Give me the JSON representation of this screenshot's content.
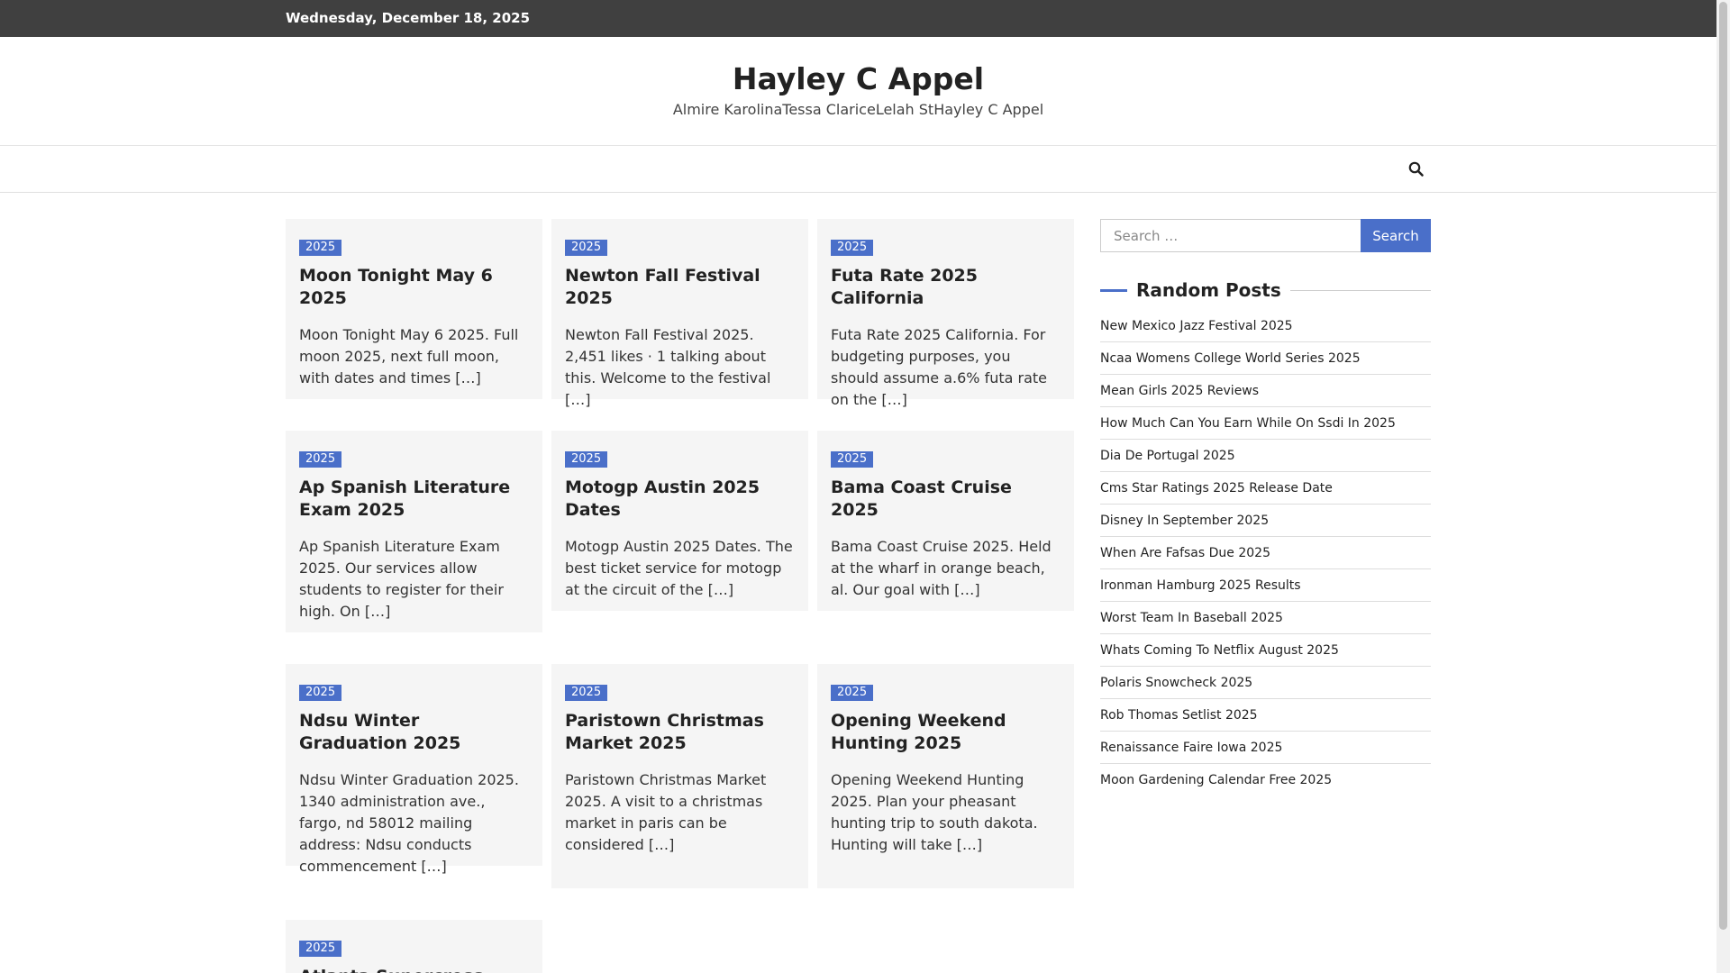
{
  "topbar": {
    "date": "Wednesday, December 18, 2025"
  },
  "header": {
    "title": "Hayley C Appel",
    "description": "Almire KarolinaTessa ClariceLelah StHayley C Appel"
  },
  "nav": {
    "search_icon": "search-icon"
  },
  "posts": [
    {
      "badge": "2025",
      "title": "Moon Tonight May 6 2025",
      "excerpt": "Moon Tonight May 6 2025. Full moon 2025, next full moon, with dates and times […]"
    },
    {
      "badge": "2025",
      "title": "Newton Fall Festival 2025",
      "excerpt": "Newton Fall Festival 2025. 2,451 likes · 1 talking about this. Welcome to the festival […]"
    },
    {
      "badge": "2025",
      "title": "Futa Rate 2025 California",
      "excerpt": "Futa Rate 2025 California. For budgeting purposes, you should assume a.6% futa rate on the […]"
    },
    {
      "badge": "2025",
      "title": "Ap Spanish Literature Exam 2025",
      "excerpt": "Ap Spanish Literature Exam 2025. Our services allow students to register for their high. On […]"
    },
    {
      "badge": "2025",
      "title": "Motogp Austin 2025 Dates",
      "excerpt": "Motogp Austin 2025 Dates. The best ticket service for motogp at the circuit of the […]"
    },
    {
      "badge": "2025",
      "title": "Bama Coast Cruise 2025",
      "excerpt": "Bama Coast Cruise 2025. Held at the wharf in orange beach, al. Our goal with […]"
    },
    {
      "badge": "2025",
      "title": "Ndsu Winter Graduation 2025",
      "excerpt": "Ndsu Winter Graduation 2025. 1340 administration ave., fargo, nd 58012 mailing address: Ndsu conducts commencement […]"
    },
    {
      "badge": "2025",
      "title": "Paristown Christmas Market 2025",
      "excerpt": "Paristown Christmas Market 2025. A visit to a christmas market in paris can be considered […]"
    },
    {
      "badge": "2025",
      "title": "Opening Weekend Hunting 2025",
      "excerpt": "Opening Weekend Hunting 2025. Plan your pheasant hunting trip to south dakota. Hunting will take […]"
    },
    {
      "badge": "2025",
      "title": "Atlanta Supercross Results",
      "excerpt": ""
    }
  ],
  "sidebar": {
    "search_placeholder": "Search …",
    "search_button": "Search",
    "widget_title": "Random Posts",
    "random_posts": [
      "New Mexico Jazz Festival 2025",
      "Ncaa Womens College World Series 2025",
      "Mean Girls 2025 Reviews",
      "How Much Can You Earn While On Ssdi In 2025",
      "Dia De Portugal 2025",
      "Cms Star Ratings 2025 Release Date",
      "Disney In September 2025",
      "When Are Fafsas Due 2025",
      "Ironman Hamburg 2025 Results",
      "Worst Team In Baseball 2025",
      "Whats Coming To Netflix August 2025",
      "Polaris Snowcheck 2025",
      "Rob Thomas Setlist 2025",
      "Renaissance Faire Iowa 2025",
      "Moon Gardening Calendar Free 2025"
    ]
  },
  "colors": {
    "accent": "#4a6fc9",
    "topbar": "#404040",
    "card_bg": "#f5f5f5"
  }
}
